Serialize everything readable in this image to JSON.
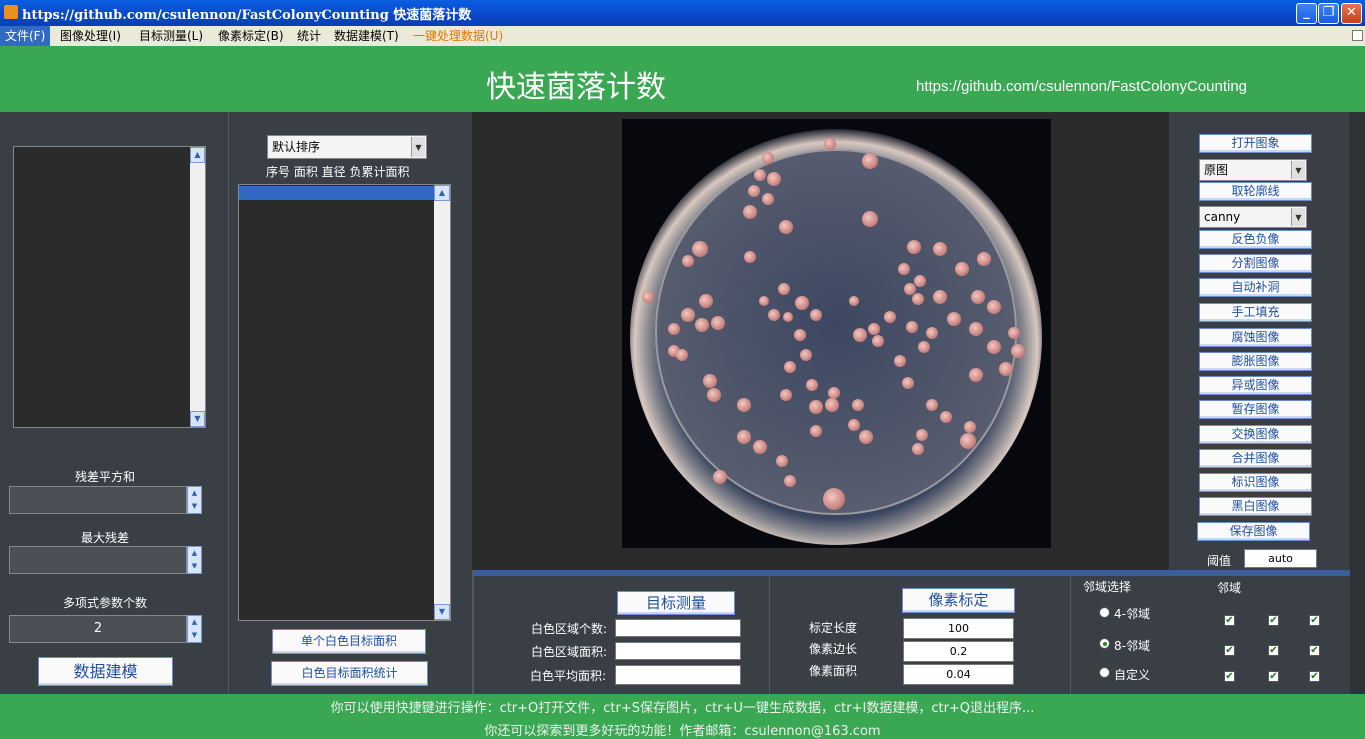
{
  "window": {
    "title": "https://github.com/csulennon/FastColonyCounting   快速菌落计数",
    "min": "_",
    "max": "❐",
    "close": "✕"
  },
  "menu": [
    "文件(F)",
    "图像处理(I)",
    "目标测量(L)",
    "像素标定(B)",
    "统计",
    "数据建模(T)",
    "一键处理数据(U)"
  ],
  "header": {
    "title": "快速菌落计数",
    "url": "https://github.com/csulennon/FastColonyCounting"
  },
  "left": {
    "residual_sum_label": "残差平方和",
    "max_residual_label": "最大残差",
    "poly_count_label": "多项式参数个数",
    "poly_count_value": "2",
    "model_button": "数据建模"
  },
  "list": {
    "sort_select": "默认排序",
    "columns": "序号  面积  直径 负累计面积",
    "single_button": "单个白色目标面积",
    "stats_button": "白色目标面积统计"
  },
  "measure": {
    "button": "目标测量",
    "count_label": "白色区域个数:",
    "area_label": "白色区域面积:",
    "avg_label": "白色平均面积:",
    "count_value": "",
    "area_value": "",
    "avg_value": ""
  },
  "calib": {
    "button": "像素标定",
    "length_label": "标定长度",
    "length_value": "100",
    "side_label": "像素边长",
    "side_value": "0.2",
    "area_label": "像素面积",
    "area_value": "0.04"
  },
  "neighbor": {
    "select_label": "邻域选择",
    "region_label": "邻域",
    "options": [
      "4-邻域",
      "8-邻域",
      "自定义"
    ],
    "selected": "8-邻域",
    "check_mark": "✔"
  },
  "tools": {
    "open": "打开图象",
    "mode_select": "原图",
    "contour": "取轮廓线",
    "edge_select": "canny",
    "buttons": [
      "反色负像",
      "分割图像",
      "自动补洞",
      "手工填充",
      "腐蚀图像",
      "膨胀图像",
      "异或图像",
      "暂存图像",
      "交换图像",
      "合并图像",
      "标识图像",
      "黑白图像",
      "保存图像"
    ],
    "threshold_label": "阈值",
    "threshold_value": "auto"
  },
  "footer": {
    "line1": "你可以使用快捷键进行操作：ctr+O打开文件，ctr+S保存图片，ctr+U一键生成数据，ctr+I数据建模，ctr+Q退出程序...",
    "line2": "你还可以探索到更多好玩的功能！作者邮箱：csulennon@163.com"
  },
  "colors": {
    "header_green": "#3aa853",
    "panel_gray": "#3a3e45",
    "title_blue": "#0a5fe0"
  }
}
